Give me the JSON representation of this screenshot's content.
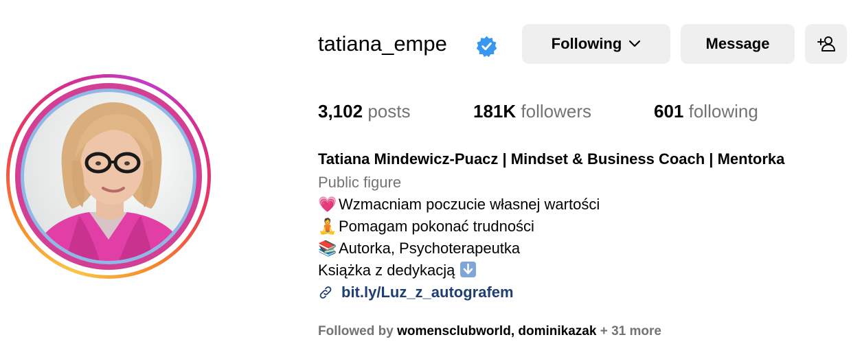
{
  "profile": {
    "username": "tatiana_empe",
    "verified": true,
    "full_name": "Tatiana Mindewicz-Puacz | Mindset & Business Coach | Mentorka",
    "category": "Public figure"
  },
  "actions": {
    "following_label": "Following",
    "message_label": "Message"
  },
  "stats": {
    "posts_count": "3,102",
    "posts_label": "posts",
    "followers_count": "181K",
    "followers_label": "followers",
    "following_count": "601",
    "following_label": "following"
  },
  "bio": {
    "line1_emoji": "💗",
    "line1": "Wzmacniam poczucie własnej wartości",
    "line2_emoji": "🧘",
    "line2": "Pomagam pokonać trudności",
    "line3_emoji": "📚",
    "line3": "Autorka, Psychoterapeutka",
    "line4": "Książka z dedykacją",
    "link": "bit.ly/Luz_z_autografem"
  },
  "followed_by": {
    "prefix": "Followed by",
    "account1": "womensclubworld",
    "separator": ",",
    "account2": "dominikazak",
    "more": "+ 31 more"
  },
  "colors": {
    "verified_badge": "#3897f0",
    "link": "#1f3f72",
    "secondary_text": "#737373",
    "button_bg": "#efefef"
  },
  "icons": [
    "verified-badge-icon",
    "chevron-down-icon",
    "add-person-icon",
    "link-icon",
    "down-arrow-icon"
  ]
}
